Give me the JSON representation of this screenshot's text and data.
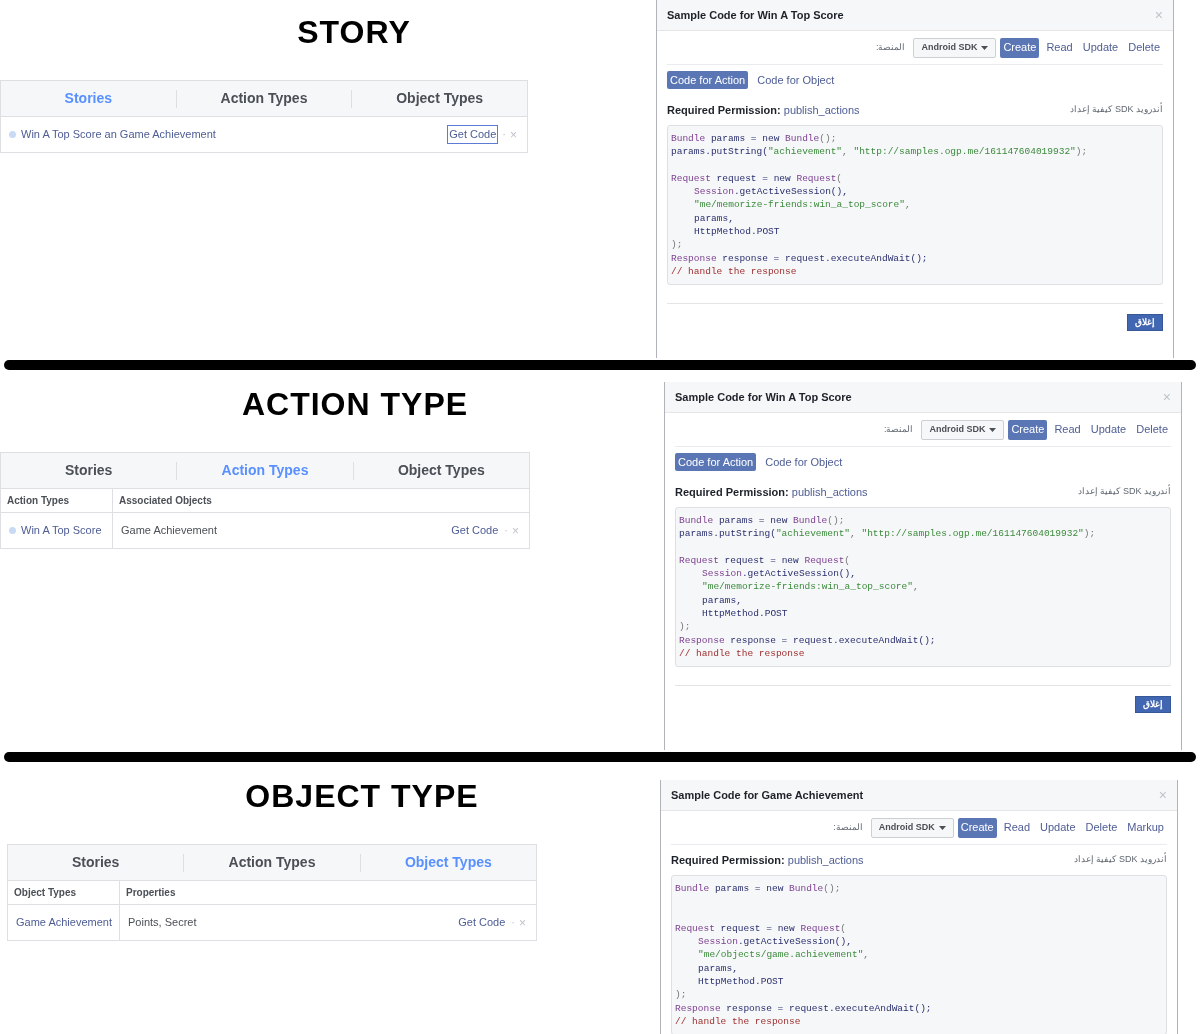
{
  "sections": [
    {
      "heading": "STORY",
      "panel": {
        "tabs": [
          {
            "label": "Stories",
            "selected": true
          },
          {
            "label": "Action Types",
            "selected": false
          },
          {
            "label": "Object Types",
            "selected": false
          }
        ],
        "rows": [
          {
            "cells": [
              {
                "kind": "dot-link",
                "text": "Win A Top Score an Game Achievement"
              }
            ],
            "action": {
              "label": "Get Code",
              "focused": true
            },
            "separator": "·",
            "remove": "×"
          }
        ]
      },
      "dialog": {
        "title": "Sample Code for Win A Top Score",
        "close": "×",
        "platform_label": "المنصة:",
        "platform": "Android SDK",
        "operations": [
          {
            "label": "Create",
            "selected": true
          },
          {
            "label": "Read",
            "selected": false
          },
          {
            "label": "Update",
            "selected": false
          },
          {
            "label": "Delete",
            "selected": false
          }
        ],
        "code_tabs": [
          {
            "label": "Code for Action",
            "selected": true
          },
          {
            "label": "Code for Object",
            "selected": false
          }
        ],
        "permission_label": "Required Permission:",
        "permission": "publish_actions",
        "setup_link": "أندرويد SDK كيفية إعداد",
        "code": [
          {
            "indent": false,
            "tokens": [
              {
                "kind": "type",
                "text": "Bundle"
              },
              {
                "kind": "ident",
                "text": " params = new "
              },
              {
                "kind": "type",
                "text": "Bundle"
              },
              {
                "kind": "punct",
                "text": "();"
              }
            ]
          },
          {
            "indent": false,
            "tokens": [
              {
                "kind": "ident",
                "text": "params.putString("
              },
              {
                "kind": "string",
                "text": "\"achievement\""
              },
              {
                "kind": "punct",
                "text": ", "
              },
              {
                "kind": "string",
                "text": "\"http://samples.ogp.me/161147604019932\""
              },
              {
                "kind": "punct",
                "text": ");"
              }
            ]
          },
          {
            "kind": "blank"
          },
          {
            "indent": false,
            "tokens": [
              {
                "kind": "type",
                "text": "Request"
              },
              {
                "kind": "ident",
                "text": " request = new "
              },
              {
                "kind": "type",
                "text": "Request"
              },
              {
                "kind": "punct",
                "text": "("
              }
            ]
          },
          {
            "indent": true,
            "tokens": [
              {
                "kind": "type",
                "text": "Session"
              },
              {
                "kind": "ident",
                "text": ".getActiveSession(),"
              }
            ]
          },
          {
            "indent": true,
            "tokens": [
              {
                "kind": "string",
                "text": "\"me/memorize-friends:win_a_top_score\""
              },
              {
                "kind": "punct",
                "text": ","
              }
            ]
          },
          {
            "indent": true,
            "tokens": [
              {
                "kind": "ident",
                "text": "params,"
              }
            ]
          },
          {
            "indent": true,
            "tokens": [
              {
                "kind": "ident",
                "text": "HttpMethod.POST"
              }
            ]
          },
          {
            "indent": false,
            "tokens": [
              {
                "kind": "punct",
                "text": ");"
              }
            ]
          },
          {
            "indent": false,
            "tokens": [
              {
                "kind": "type",
                "text": "Response"
              },
              {
                "kind": "ident",
                "text": " response = request.executeAndWait();"
              }
            ]
          },
          {
            "indent": false,
            "tokens": [
              {
                "kind": "comment",
                "text": "// handle the response"
              }
            ]
          }
        ],
        "footer_button": "إغلاق"
      }
    },
    {
      "heading": "ACTION TYPE",
      "panel": {
        "tabs": [
          {
            "label": "Stories",
            "selected": false
          },
          {
            "label": "Action Types",
            "selected": true
          },
          {
            "label": "Object Types",
            "selected": false
          }
        ],
        "columns": [
          "Action Types",
          "Associated Objects"
        ],
        "rows": [
          {
            "cells": [
              {
                "kind": "dot-link",
                "text": "Win A Top Score"
              },
              {
                "kind": "text",
                "text": "Game Achievement"
              }
            ],
            "action": {
              "label": "Get Code",
              "focused": false
            },
            "separator": "·",
            "remove": "×"
          }
        ]
      },
      "dialog": {
        "title": "Sample Code for Win A Top Score",
        "close": "×",
        "platform_label": "المنصة:",
        "platform": "Android SDK",
        "operations": [
          {
            "label": "Create",
            "selected": true
          },
          {
            "label": "Read",
            "selected": false
          },
          {
            "label": "Update",
            "selected": false
          },
          {
            "label": "Delete",
            "selected": false
          }
        ],
        "code_tabs": [
          {
            "label": "Code for Action",
            "selected": true
          },
          {
            "label": "Code for Object",
            "selected": false
          }
        ],
        "permission_label": "Required Permission:",
        "permission": "publish_actions",
        "setup_link": "أندرويد SDK كيفية إعداد",
        "code": [
          {
            "indent": false,
            "tokens": [
              {
                "kind": "type",
                "text": "Bundle"
              },
              {
                "kind": "ident",
                "text": " params = new "
              },
              {
                "kind": "type",
                "text": "Bundle"
              },
              {
                "kind": "punct",
                "text": "();"
              }
            ]
          },
          {
            "indent": false,
            "tokens": [
              {
                "kind": "ident",
                "text": "params.putString("
              },
              {
                "kind": "string",
                "text": "\"achievement\""
              },
              {
                "kind": "punct",
                "text": ", "
              },
              {
                "kind": "string",
                "text": "\"http://samples.ogp.me/161147604019932\""
              },
              {
                "kind": "punct",
                "text": ");"
              }
            ]
          },
          {
            "kind": "blank"
          },
          {
            "indent": false,
            "tokens": [
              {
                "kind": "type",
                "text": "Request"
              },
              {
                "kind": "ident",
                "text": " request = new "
              },
              {
                "kind": "type",
                "text": "Request"
              },
              {
                "kind": "punct",
                "text": "("
              }
            ]
          },
          {
            "indent": true,
            "tokens": [
              {
                "kind": "type",
                "text": "Session"
              },
              {
                "kind": "ident",
                "text": ".getActiveSession(),"
              }
            ]
          },
          {
            "indent": true,
            "tokens": [
              {
                "kind": "string",
                "text": "\"me/memorize-friends:win_a_top_score\""
              },
              {
                "kind": "punct",
                "text": ","
              }
            ]
          },
          {
            "indent": true,
            "tokens": [
              {
                "kind": "ident",
                "text": "params,"
              }
            ]
          },
          {
            "indent": true,
            "tokens": [
              {
                "kind": "ident",
                "text": "HttpMethod.POST"
              }
            ]
          },
          {
            "indent": false,
            "tokens": [
              {
                "kind": "punct",
                "text": ");"
              }
            ]
          },
          {
            "indent": false,
            "tokens": [
              {
                "kind": "type",
                "text": "Response"
              },
              {
                "kind": "ident",
                "text": " response = request.executeAndWait();"
              }
            ]
          },
          {
            "indent": false,
            "tokens": [
              {
                "kind": "comment",
                "text": "// handle the response"
              }
            ]
          }
        ],
        "footer_button": "إغلاق"
      }
    },
    {
      "heading": "OBJECT TYPE",
      "panel": {
        "tabs": [
          {
            "label": "Stories",
            "selected": false
          },
          {
            "label": "Action Types",
            "selected": false
          },
          {
            "label": "Object Types",
            "selected": true
          }
        ],
        "columns": [
          "Object Types",
          "Properties"
        ],
        "rows": [
          {
            "cells": [
              {
                "kind": "link",
                "text": "Game Achievement"
              },
              {
                "kind": "text",
                "text": "Points, Secret"
              }
            ],
            "action": {
              "label": "Get Code",
              "focused": false
            },
            "separator": "·",
            "remove": "×"
          }
        ]
      },
      "dialog": {
        "title": "Sample Code for Game Achievement",
        "close": "×",
        "platform_label": "المنصة:",
        "platform": "Android SDK",
        "operations": [
          {
            "label": "Create",
            "selected": true
          },
          {
            "label": "Read",
            "selected": false
          },
          {
            "label": "Update",
            "selected": false
          },
          {
            "label": "Delete",
            "selected": false
          },
          {
            "label": "Markup",
            "selected": false
          }
        ],
        "permission_label": "Required Permission:",
        "permission": "publish_actions",
        "setup_link": "أندرويد SDK كيفية إعداد",
        "code": [
          {
            "indent": false,
            "tokens": [
              {
                "kind": "type",
                "text": "Bundle"
              },
              {
                "kind": "ident",
                "text": " params = new "
              },
              {
                "kind": "type",
                "text": "Bundle"
              },
              {
                "kind": "punct",
                "text": "();"
              }
            ]
          },
          {
            "kind": "blank"
          },
          {
            "kind": "blank"
          },
          {
            "indent": false,
            "tokens": [
              {
                "kind": "type",
                "text": "Request"
              },
              {
                "kind": "ident",
                "text": " request = new "
              },
              {
                "kind": "type",
                "text": "Request"
              },
              {
                "kind": "punct",
                "text": "("
              }
            ]
          },
          {
            "indent": true,
            "tokens": [
              {
                "kind": "type",
                "text": "Session"
              },
              {
                "kind": "ident",
                "text": ".getActiveSession(),"
              }
            ]
          },
          {
            "indent": true,
            "tokens": [
              {
                "kind": "string",
                "text": "\"me/objects/game.achievement\""
              },
              {
                "kind": "punct",
                "text": ","
              }
            ]
          },
          {
            "indent": true,
            "tokens": [
              {
                "kind": "ident",
                "text": "params,"
              }
            ]
          },
          {
            "indent": true,
            "tokens": [
              {
                "kind": "ident",
                "text": "HttpMethod.POST"
              }
            ]
          },
          {
            "indent": false,
            "tokens": [
              {
                "kind": "punct",
                "text": ");"
              }
            ]
          },
          {
            "indent": false,
            "tokens": [
              {
                "kind": "type",
                "text": "Response"
              },
              {
                "kind": "ident",
                "text": " response = request.executeAndWait();"
              }
            ]
          },
          {
            "indent": false,
            "tokens": [
              {
                "kind": "comment",
                "text": "// handle the response"
              }
            ]
          }
        ]
      }
    }
  ]
}
